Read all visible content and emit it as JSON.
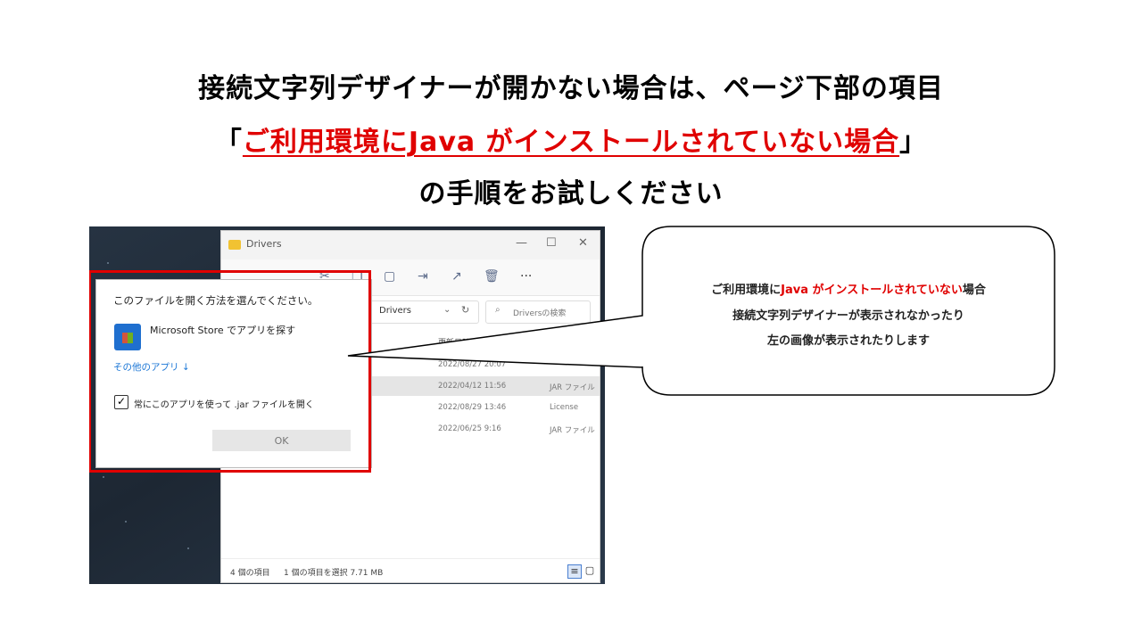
{
  "heading": {
    "line1": "接続文字列デザイナーが開かない場合は、ページ下部の項目",
    "line2_open": "「",
    "line2_link": "ご利用環境にJava がインストールされていない場合",
    "line2_close": "」",
    "line3": "の手順をお試しください"
  },
  "explorer": {
    "title": "Drivers",
    "window_controls": [
      "—",
      "☐",
      "✕"
    ],
    "toolbar_more": "···",
    "address": "Drivers",
    "search_placeholder": "Driversの検索",
    "column_date": "更新日時",
    "files": [
      {
        "date": "2022/08/27 20:07",
        "type": ""
      },
      {
        "date": "2022/04/12 11:56",
        "type": "JAR ファイル"
      },
      {
        "date": "2022/08/29 13:46",
        "type": "License"
      },
      {
        "date": "2022/06/25 9:16",
        "type": "JAR ファイル"
      }
    ],
    "status_count": "4 個の項目",
    "status_selected": "1 個の項目を選択  7.71 MB"
  },
  "dialog": {
    "title": "このファイルを開く方法を選んでください。",
    "store_option": "Microsoft Store でアプリを探す",
    "other_apps": "その他のアプリ ↓",
    "checkbox_label": "常にこのアプリを使って .jar ファイルを開く",
    "checkbox_checked": true,
    "ok_label": "OK"
  },
  "callout": {
    "line1_pre": "ご利用環境に",
    "line1_red": "Java がインストールされていない",
    "line1_post": "場合",
    "line2": "接続文字列デザイナーが表示されなかったり",
    "line3": "左の画像が表示されたりします"
  },
  "colors": {
    "accent_red": "#e00000",
    "link_blue": "#1c77d6"
  }
}
